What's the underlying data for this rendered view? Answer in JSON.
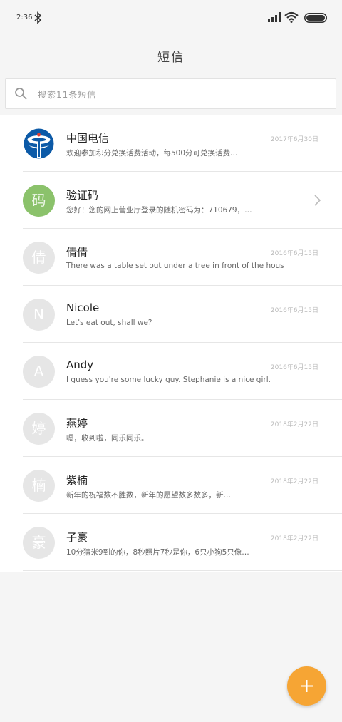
{
  "status": {
    "time": "2:36"
  },
  "header": {
    "title": "短信"
  },
  "search": {
    "placeholder": "搜索11条短信"
  },
  "conversations": [
    {
      "name": "中国电信",
      "preview": "欢迎参加积分兑换话费活动，每500分可兑换话费…",
      "date": "2017年6月30日",
      "avatar": "china-telecom-logo"
    },
    {
      "name": "验证码",
      "preview": "您好！您的网上营业厅登录的随机密码为：710679，…",
      "date": "",
      "avatar_text": "码"
    },
    {
      "name": "倩倩",
      "preview": "There was a table set out under a tree in front of the hous",
      "date": "2016年6月15日",
      "avatar_text": "倩"
    },
    {
      "name": "Nicole",
      "preview": "Let's eat out, shall we?",
      "date": "2016年6月15日",
      "avatar_text": "N"
    },
    {
      "name": "Andy",
      "preview": "I guess you're some lucky guy. Stephanie is a nice girl.",
      "date": "2016年6月15日",
      "avatar_text": "A"
    },
    {
      "name": "燕婷",
      "preview": "嗯，收到啦，同乐同乐。",
      "date": "2018年2月22日",
      "avatar_text": "婷"
    },
    {
      "name": "紫楠",
      "preview": "新年的祝福数不胜数，新年的愿望数多数多，新…",
      "date": "2018年2月22日",
      "avatar_text": "楠"
    },
    {
      "name": "子豪",
      "preview": "10分猜米9到的你，8秒照片7秒是你，6只小狗5只像…",
      "date": "2018年2月22日",
      "avatar_text": "豪"
    }
  ],
  "colors": {
    "accent": "#f6a534",
    "avatar_green": "#8bc26b",
    "avatar_grey": "#e6e6e6",
    "telecom_blue": "#0c5aa7"
  }
}
